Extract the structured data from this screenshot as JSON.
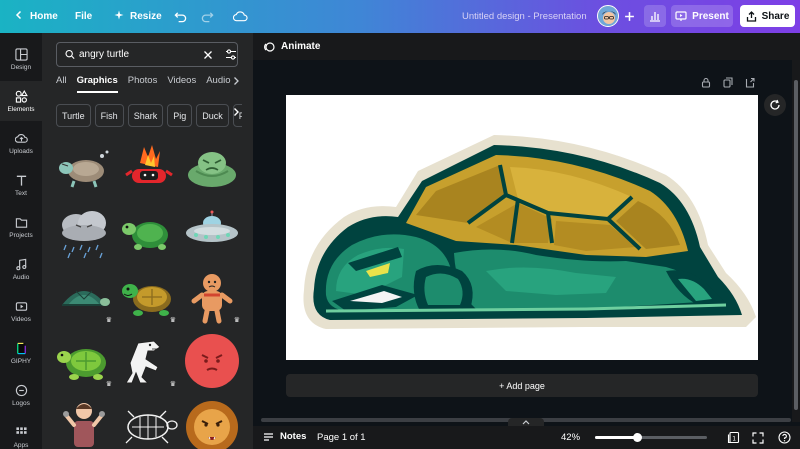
{
  "topbar": {
    "home_label": "Home",
    "file_label": "File",
    "resize_label": "Resize",
    "design_title": "Untitled design - Presentation",
    "present_label": "Present",
    "share_label": "Share"
  },
  "rail": {
    "items": [
      {
        "label": "Design",
        "icon": "layout-icon"
      },
      {
        "label": "Elements",
        "icon": "shapes-icon"
      },
      {
        "label": "Uploads",
        "icon": "cloud-upload-icon"
      },
      {
        "label": "Text",
        "icon": "text-icon"
      },
      {
        "label": "Projects",
        "icon": "folder-icon"
      },
      {
        "label": "Audio",
        "icon": "music-icon"
      },
      {
        "label": "Videos",
        "icon": "video-icon"
      },
      {
        "label": "GIPHY",
        "icon": "giphy-icon"
      },
      {
        "label": "Logos",
        "icon": "logo-icon"
      },
      {
        "label": "Apps",
        "icon": "apps-icon"
      }
    ]
  },
  "panel": {
    "search_value": "angry turtle",
    "tabs": [
      "All",
      "Graphics",
      "Photos",
      "Videos",
      "Audio"
    ],
    "active_tab": "Graphics",
    "chips": [
      "Turtle",
      "Fish",
      "Shark",
      "Pig",
      "Duck",
      "Fr"
    ]
  },
  "editor": {
    "animate_label": "Animate",
    "add_page_label": "+ Add page"
  },
  "bottombar": {
    "notes_label": "Notes",
    "page_label": "Page 1 of 1",
    "zoom_label": "42%",
    "zoom_value": 42
  },
  "colors": {
    "accent_gradient_start": "#1ab3c4",
    "accent_gradient_end": "#7d3fe6",
    "turtle_dark": "#00433f",
    "turtle_green": "#1d8c6d",
    "turtle_shell": "#c7a02d"
  }
}
